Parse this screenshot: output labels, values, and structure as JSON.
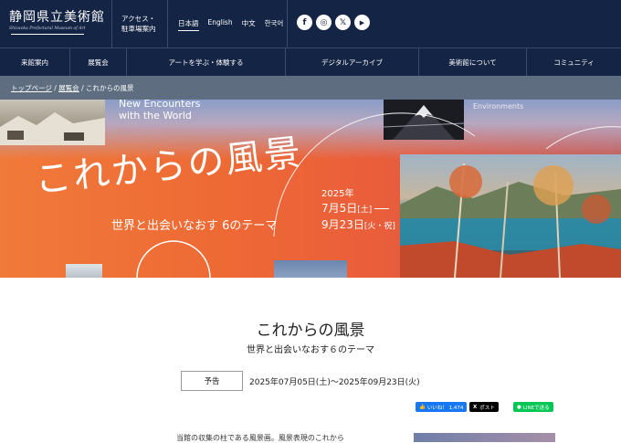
{
  "header": {
    "logo_title": "静岡県立美術館",
    "logo_subtitle": "Shizuoka Prefectural Museum of Art",
    "access_line1": "アクセス・",
    "access_line2": "駐車場案内",
    "languages": [
      "日本語",
      "English",
      "中文",
      "한국어"
    ],
    "social": [
      {
        "icon": "facebook-icon",
        "glyph": "f"
      },
      {
        "icon": "instagram-icon",
        "glyph": "◎"
      },
      {
        "icon": "x-icon",
        "glyph": "𝕏"
      },
      {
        "icon": "youtube-icon",
        "glyph": "▶"
      }
    ]
  },
  "nav": {
    "items": [
      "来館案内",
      "展覧会",
      "アートを学ぶ・体験する",
      "デジタルアーカイブ",
      "美術館について",
      "コミュニティ"
    ]
  },
  "breadcrumb": {
    "home": "トップページ",
    "section": "展覧会",
    "current": "これからの風景"
  },
  "hero": {
    "english_line1": "New Encounters",
    "english_line2": "with the World",
    "english_right": "Environments",
    "title": "これからの風景",
    "subtitle": "世界と出会いなおす 6のテーマ",
    "year": "2025年",
    "start": "7月5日",
    "start_day": "[土]",
    "end": "9月23日",
    "end_day": "[火・祝]"
  },
  "exhibition": {
    "title": "これからの風景",
    "subtitle": "世界と出会いなおす６のテーマ",
    "status": "予告",
    "period": "2025年07月05日(土)〜2025年09月23日(火)"
  },
  "share": {
    "facebook_label": "いいね！ 1,474",
    "x_label": "ポスト",
    "line_label": "LINEで送る"
  },
  "body": {
    "intro": "当館の収集の柱である風景画。風景表現のこれから"
  },
  "colors": {
    "header_bg": "#142444",
    "breadcrumb_bg": "#5e6d80",
    "hero_orange": "#ee6a35",
    "facebook": "#1877f2",
    "x": "#000000",
    "line": "#06c755"
  }
}
